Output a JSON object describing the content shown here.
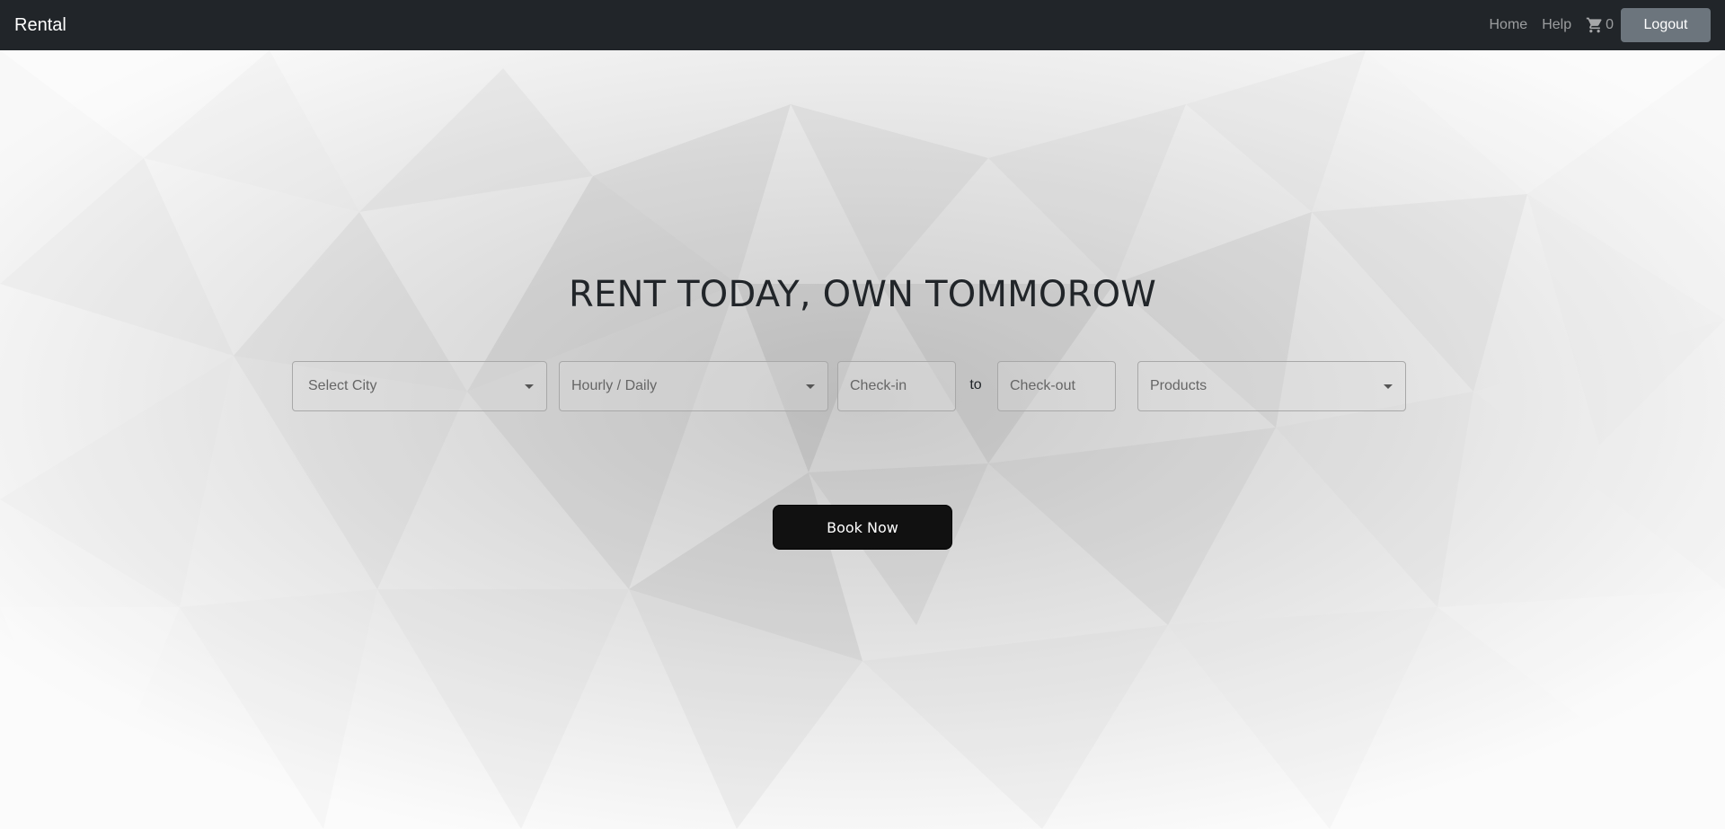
{
  "navbar": {
    "brand": "Rental",
    "links": {
      "home": "Home",
      "help": "Help"
    },
    "cart_count": "0",
    "logout_label": "Logout"
  },
  "hero": {
    "headline": "RENT TODAY, OWN TOMMOROW",
    "city_select": "Select City",
    "rate_select": "Hourly / Daily",
    "checkin_placeholder": "Check-in",
    "to_label": "to",
    "checkout_placeholder": "Check-out",
    "products_select": "Products",
    "book_label": "Book Now"
  },
  "icons": {
    "cart": "cart-icon",
    "dropdown": "caret-down-icon"
  },
  "colors": {
    "navbar_bg": "#212529",
    "logout_bg": "#6c757d",
    "book_bg": "#111111"
  }
}
